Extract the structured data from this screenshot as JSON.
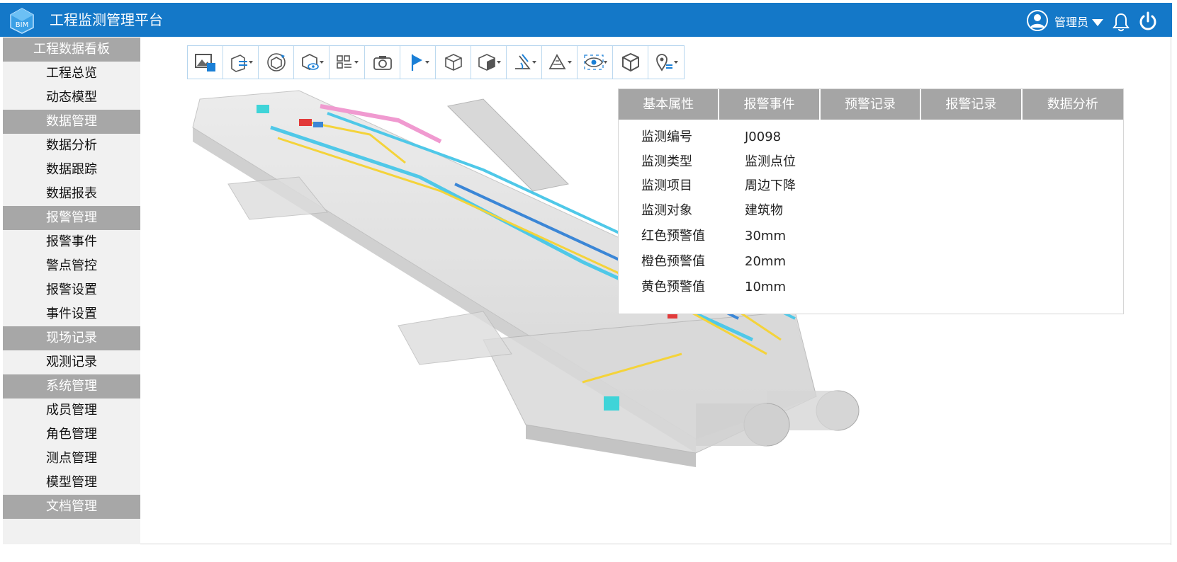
{
  "header": {
    "app_title": "工程监测管理平台",
    "user_name": "管理员",
    "icons": [
      "bim-logo-icon",
      "user-avatar-icon",
      "caret-down-icon",
      "bell-icon",
      "power-icon"
    ],
    "bg_color": "#1478c8"
  },
  "sidebar": {
    "items": [
      {
        "label": "工程数据看板",
        "group": true
      },
      {
        "label": "工程总览",
        "group": false
      },
      {
        "label": "动态模型",
        "group": false
      },
      {
        "label": "数据管理",
        "group": true
      },
      {
        "label": "数据分析",
        "group": false
      },
      {
        "label": "数据跟踪",
        "group": false
      },
      {
        "label": "数据报表",
        "group": false
      },
      {
        "label": "报警管理",
        "group": true
      },
      {
        "label": "报警事件",
        "group": false
      },
      {
        "label": "警点管控",
        "group": false
      },
      {
        "label": "报警设置",
        "group": false
      },
      {
        "label": "事件设置",
        "group": false
      },
      {
        "label": "现场记录",
        "group": true
      },
      {
        "label": "观测记录",
        "group": false
      },
      {
        "label": "系统管理",
        "group": true
      },
      {
        "label": "成员管理",
        "group": false
      },
      {
        "label": "角色管理",
        "group": false
      },
      {
        "label": "测点管理",
        "group": false
      },
      {
        "label": "模型管理",
        "group": false
      },
      {
        "label": "文档管理",
        "group": true
      }
    ],
    "group_color": "#a7a7a7"
  },
  "toolbar": {
    "tools": [
      "image-save-icon",
      "section-box-icon",
      "rotate-model-icon",
      "view-mode-icon",
      "list-grid-icon",
      "camera-icon",
      "flag-icon",
      "cube-outline-icon",
      "cube-shaded-icon",
      "measure-angle-icon",
      "measure-area-icon",
      "eye-visibility-icon",
      "cube-3d-icon",
      "location-pin-icon"
    ]
  },
  "panel": {
    "tabs": [
      "基本属性",
      "报警事件",
      "预警记录",
      "报警记录",
      "数据分析"
    ],
    "properties": [
      {
        "key": "监测编号",
        "value": "J0098"
      },
      {
        "key": "监测类型",
        "value": "监测点位"
      },
      {
        "key": "监测项目",
        "value": "周边下降"
      },
      {
        "key": "监测对象",
        "value": "建筑物"
      },
      {
        "key": "红色预警值",
        "value": "30mm"
      },
      {
        "key": "橙色预警值",
        "value": "20mm"
      },
      {
        "key": "黄色预警值",
        "value": "10mm"
      }
    ],
    "tab_color": "#a5a5a5"
  }
}
